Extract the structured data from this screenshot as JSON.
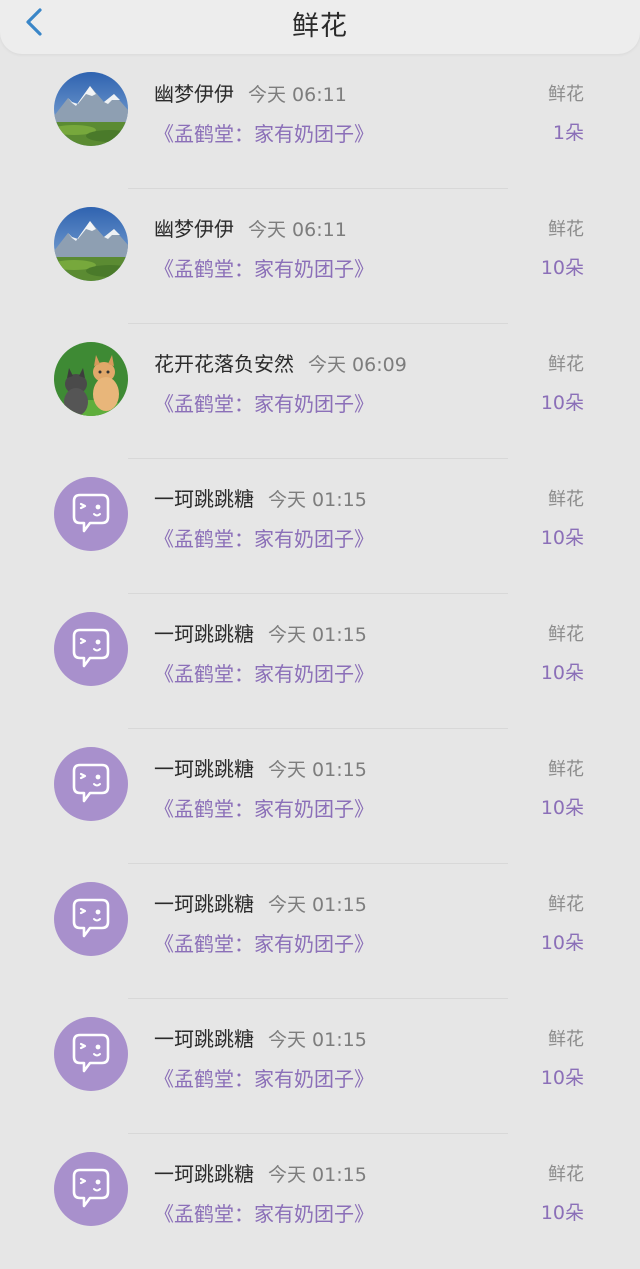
{
  "header": {
    "title": "鲜花"
  },
  "rows": [
    {
      "avatar": "mountain",
      "name": "幽梦伊伊",
      "time": "今天 06:11",
      "book": "《孟鹤堂：家有奶团子》",
      "type": "鲜花",
      "count": "1朵"
    },
    {
      "avatar": "mountain",
      "name": "幽梦伊伊",
      "time": "今天 06:11",
      "book": "《孟鹤堂：家有奶团子》",
      "type": "鲜花",
      "count": "10朵"
    },
    {
      "avatar": "cats",
      "name": "花开花落负安然",
      "time": "今天 06:09",
      "book": "《孟鹤堂：家有奶团子》",
      "type": "鲜花",
      "count": "10朵"
    },
    {
      "avatar": "default",
      "name": "一珂跳跳糖",
      "time": "今天 01:15",
      "book": "《孟鹤堂：家有奶团子》",
      "type": "鲜花",
      "count": "10朵"
    },
    {
      "avatar": "default",
      "name": "一珂跳跳糖",
      "time": "今天 01:15",
      "book": "《孟鹤堂：家有奶团子》",
      "type": "鲜花",
      "count": "10朵"
    },
    {
      "avatar": "default",
      "name": "一珂跳跳糖",
      "time": "今天 01:15",
      "book": "《孟鹤堂：家有奶团子》",
      "type": "鲜花",
      "count": "10朵"
    },
    {
      "avatar": "default",
      "name": "一珂跳跳糖",
      "time": "今天 01:15",
      "book": "《孟鹤堂：家有奶团子》",
      "type": "鲜花",
      "count": "10朵"
    },
    {
      "avatar": "default",
      "name": "一珂跳跳糖",
      "time": "今天 01:15",
      "book": "《孟鹤堂：家有奶团子》",
      "type": "鲜花",
      "count": "10朵"
    },
    {
      "avatar": "default",
      "name": "一珂跳跳糖",
      "time": "今天 01:15",
      "book": "《孟鹤堂：家有奶团子》",
      "type": "鲜花",
      "count": "10朵"
    }
  ],
  "colors": {
    "accent": "#8b6fb8",
    "back": "#3a86c8",
    "avatar_default": "#a890cc"
  }
}
